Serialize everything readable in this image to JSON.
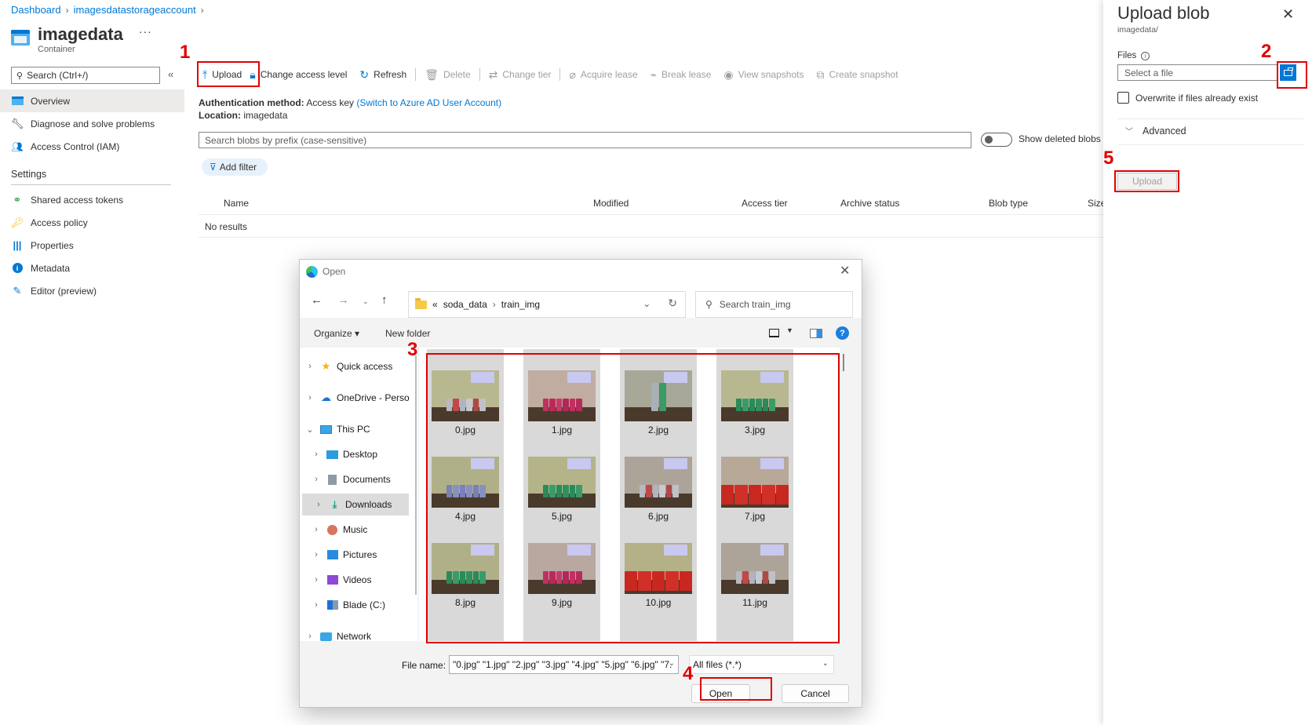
{
  "breadcrumb": [
    "Dashboard",
    "imagesdatastorageaccount"
  ],
  "header": {
    "title": "imagedata",
    "subtitle": "Container",
    "more": "···"
  },
  "nav": {
    "search_placeholder": "Search (Ctrl+/)",
    "collapse": "«",
    "items": [
      {
        "label": "Overview",
        "icon": "container-icon",
        "active": true
      },
      {
        "label": "Diagnose and solve problems",
        "icon": "wrench-icon"
      },
      {
        "label": "Access Control (IAM)",
        "icon": "people-icon"
      }
    ],
    "settings_title": "Settings",
    "settings_items": [
      {
        "label": "Shared access tokens",
        "icon": "link-icon"
      },
      {
        "label": "Access policy",
        "icon": "key-icon"
      },
      {
        "label": "Properties",
        "icon": "properties-icon"
      },
      {
        "label": "Metadata",
        "icon": "info-icon"
      },
      {
        "label": "Editor (preview)",
        "icon": "pencil-icon"
      }
    ]
  },
  "toolbar": {
    "upload": "Upload",
    "change_access": "Change access level",
    "refresh": "Refresh",
    "delete": "Delete",
    "change_tier": "Change tier",
    "acquire_lease": "Acquire lease",
    "break_lease": "Break lease",
    "view_snapshots": "View snapshots",
    "create_snapshot": "Create snapshot"
  },
  "auth": {
    "method_label": "Authentication method:",
    "method_value": "Access key",
    "switch_link": "(Switch to Azure AD User Account)",
    "location_label": "Location:",
    "location_value": "imagedata"
  },
  "blob_search": {
    "placeholder": "Search blobs by prefix (case-sensitive)"
  },
  "show_deleted": {
    "label": "Show deleted blobs",
    "on": false
  },
  "add_filter": "Add filter",
  "table": {
    "columns": [
      "Name",
      "Modified",
      "Access tier",
      "Archive status",
      "Blob type",
      "Size"
    ],
    "empty": "No results"
  },
  "upload_panel": {
    "title": "Upload blob",
    "subtitle": "imagedata/",
    "files_label": "Files",
    "file_placeholder": "Select a file",
    "overwrite_label": "Overwrite if files already exist",
    "overwrite_checked": false,
    "advanced": "Advanced",
    "upload_button": "Upload"
  },
  "dialog": {
    "title": "Open",
    "path": [
      "«",
      "soda_data",
      "train_img"
    ],
    "search_placeholder": "Search train_img",
    "organize": "Organize ▾",
    "new_folder": "New folder",
    "tree": [
      {
        "label": "Quick access",
        "icon": "star-icon",
        "level": 0,
        "expanded": false
      },
      {
        "label": "OneDrive - Perso",
        "icon": "cloud-icon",
        "level": 0,
        "expanded": false
      },
      {
        "label": "This PC",
        "icon": "pc-icon",
        "level": 0,
        "expanded": true
      },
      {
        "label": "Desktop",
        "icon": "desktop-icon",
        "level": 1,
        "expanded": false
      },
      {
        "label": "Documents",
        "icon": "documents-icon",
        "level": 1,
        "expanded": false
      },
      {
        "label": "Downloads",
        "icon": "downloads-icon",
        "level": 1,
        "expanded": false,
        "selected": true
      },
      {
        "label": "Music",
        "icon": "music-icon",
        "level": 1,
        "expanded": false
      },
      {
        "label": "Pictures",
        "icon": "pictures-icon",
        "level": 1,
        "expanded": false
      },
      {
        "label": "Videos",
        "icon": "videos-icon",
        "level": 1,
        "expanded": false
      },
      {
        "label": "Blade (C:)",
        "icon": "drive-icon",
        "level": 1,
        "expanded": false
      },
      {
        "label": "Network",
        "icon": "network-icon",
        "level": 0,
        "expanded": false
      }
    ],
    "files": [
      {
        "name": "0.jpg",
        "cans": "silver"
      },
      {
        "name": "1.jpg",
        "cans": "pink"
      },
      {
        "name": "2.jpg",
        "cans": "stacked"
      },
      {
        "name": "3.jpg",
        "cans": "green"
      },
      {
        "name": "4.jpg",
        "cans": "blue"
      },
      {
        "name": "5.jpg",
        "cans": "green"
      },
      {
        "name": "6.jpg",
        "cans": "silver"
      },
      {
        "name": "7.jpg",
        "cans": "red"
      },
      {
        "name": "8.jpg",
        "cans": "green"
      },
      {
        "name": "9.jpg",
        "cans": "pink"
      },
      {
        "name": "10.jpg",
        "cans": "red"
      },
      {
        "name": "11.jpg",
        "cans": "silver"
      }
    ],
    "file_name_label": "File name:",
    "file_name_value": "\"0.jpg\" \"1.jpg\" \"2.jpg\" \"3.jpg\" \"4.jpg\" \"5.jpg\" \"6.jpg\" \"7.",
    "file_type": "All files (*.*)",
    "open_button": "Open",
    "cancel_button": "Cancel"
  },
  "annotations": [
    "1",
    "2",
    "3",
    "4",
    "5"
  ],
  "colors": {
    "accent": "#0078d4",
    "annotation": "#e00000"
  }
}
